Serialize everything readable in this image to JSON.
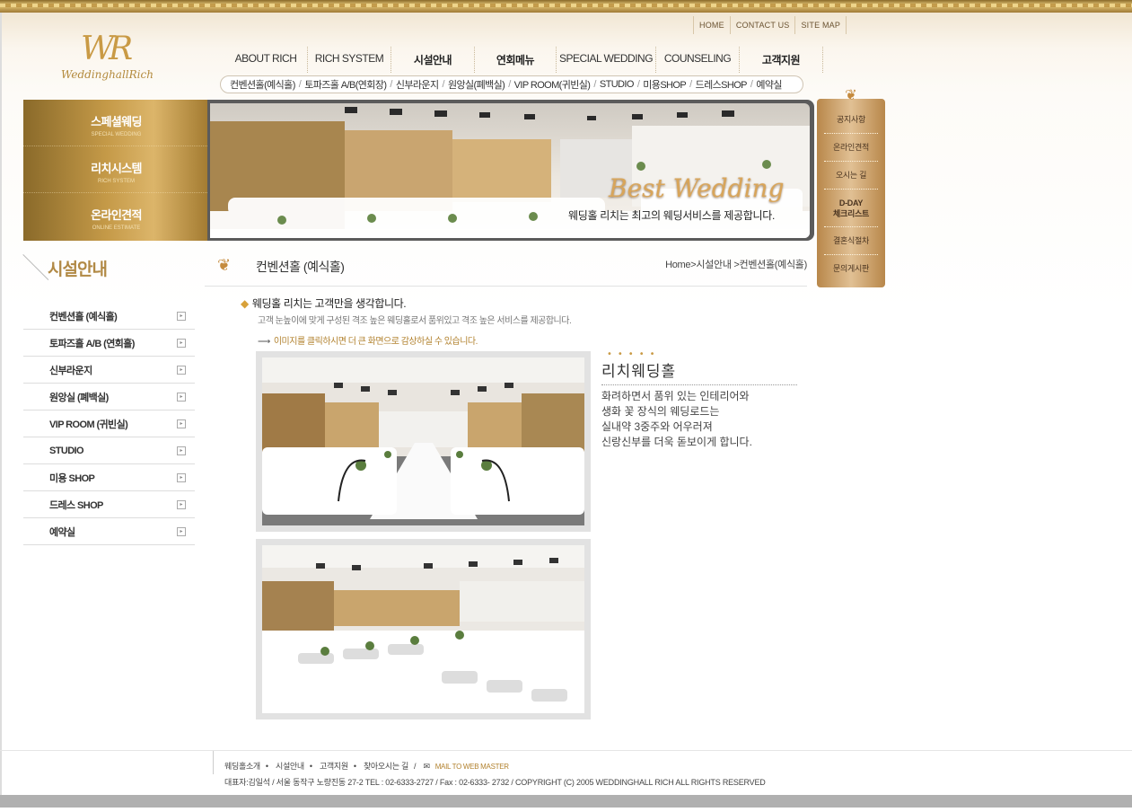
{
  "util_nav": [
    "HOME",
    "CONTACT US",
    "SITE MAP"
  ],
  "logo": {
    "mark": "WR",
    "text": "WeddinghallRich"
  },
  "gnb": [
    {
      "label": "ABOUT RICH"
    },
    {
      "label": "RICH SYSTEM"
    },
    {
      "label": "시설안내"
    },
    {
      "label": "연회메뉴"
    },
    {
      "label": "SPECIAL WEDDING"
    },
    {
      "label": "COUNSELING"
    },
    {
      "label": "고객지원"
    }
  ],
  "subnav": [
    "컨벤션홀(예식홀)",
    "토파즈홀 A/B(연회장)",
    "신부라운지",
    "원앙실(폐백실)",
    "VIP ROOM(귀빈실)",
    "STUDIO",
    "미용SHOP",
    "드레스SHOP",
    "예약실"
  ],
  "gold_menu": [
    {
      "ko": "스페셜웨딩",
      "en": "SPECIAL WEDDING"
    },
    {
      "ko": "리치시스템",
      "en": "RICH SYSTEM"
    },
    {
      "ko": "온라인견적",
      "en": "ONLINE ESTIMATE"
    }
  ],
  "banner": {
    "title": "Best Wedding",
    "subtitle": "웨딩홀 리치는 최고의 웨딩서비스를 제공합니다."
  },
  "quick_menu": [
    "공지사항",
    "온라인견적",
    "오시는 길",
    "D-DAY",
    "체크리스트",
    "결혼식절차",
    "문의게시판"
  ],
  "side_title": "시설안내",
  "lnb": [
    "컨벤션홀 (예식홀)",
    "토파즈홀 A/B (연회홀)",
    "신부라운지",
    "원앙실 (폐백실)",
    "VIP ROOM (귀빈실)",
    "STUDIO",
    "미용 SHOP",
    "드레스 SHOP",
    "예약실"
  ],
  "content": {
    "title": "컨벤션홀 (예식홀)",
    "breadcrumb": "Home>시설안내 >컨벤션홀(예식홀)",
    "intro_heading": "웨딩홀 리치는 고객만을 생각합니다.",
    "intro_text": "고객 눈높이에 맞게 구성된 격조 높은 웨딩홀로서 품위있고 격조 높은 서비스를 제공합니다.",
    "click_hint": "이미지를 클릭하시면 더 큰 화면으로 감상하실 수 있습니다.",
    "desc_title": "리치웨딩홀",
    "desc_lines": [
      "화려하면서 품위 있는 인테리어와",
      "생화 꽃 장식의 웨딩로드는",
      "실내약 3중주와 어우러져",
      "신랑신부를 더욱 돋보이게 합니다."
    ]
  },
  "footer": {
    "links": [
      "웨딩홀소개",
      "시설안내",
      "고객지원",
      "찾아오시는 길"
    ],
    "mail": "MAIL TO WEB MASTER",
    "address": "대표자:김일석 / 서울 동작구 노량진동 27-2   TEL : 02-6333-2727  /  Fax : 02-6333- 2732   /   COPYRIGHT (C) 2005 WEDDINGHALL RICH  ALL RIGHTS RESERVED"
  }
}
